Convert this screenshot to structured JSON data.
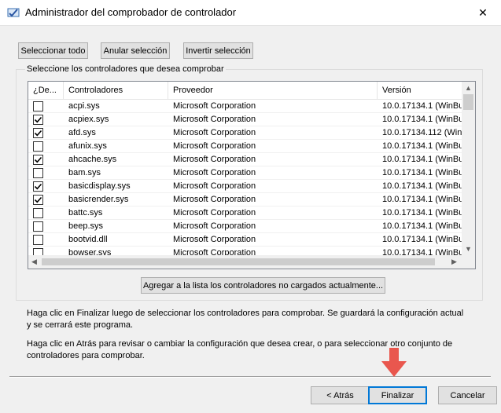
{
  "window": {
    "title": "Administrador del comprobador de controlador",
    "close_glyph": "✕"
  },
  "toolbar": {
    "select_all": "Seleccionar todo",
    "deselect": "Anular selección",
    "invert": "Invertir selección"
  },
  "group": {
    "legend": "Seleccione los controladores que desea comprobar"
  },
  "table": {
    "headers": [
      "¿De...",
      "Controladores",
      "Proveedor",
      "Versión"
    ],
    "rows": [
      {
        "checked": false,
        "name": "acpi.sys",
        "vendor": "Microsoft Corporation",
        "version": "10.0.17134.1 (WinBu"
      },
      {
        "checked": true,
        "name": "acpiex.sys",
        "vendor": "Microsoft Corporation",
        "version": "10.0.17134.1 (WinBu"
      },
      {
        "checked": true,
        "name": "afd.sys",
        "vendor": "Microsoft Corporation",
        "version": "10.0.17134.112 (Win"
      },
      {
        "checked": false,
        "name": "afunix.sys",
        "vendor": "Microsoft Corporation",
        "version": "10.0.17134.1 (WinBu"
      },
      {
        "checked": true,
        "name": "ahcache.sys",
        "vendor": "Microsoft Corporation",
        "version": "10.0.17134.1 (WinBu"
      },
      {
        "checked": false,
        "name": "bam.sys",
        "vendor": "Microsoft Corporation",
        "version": "10.0.17134.1 (WinBu"
      },
      {
        "checked": true,
        "name": "basicdisplay.sys",
        "vendor": "Microsoft Corporation",
        "version": "10.0.17134.1 (WinBu"
      },
      {
        "checked": true,
        "name": "basicrender.sys",
        "vendor": "Microsoft Corporation",
        "version": "10.0.17134.1 (WinBu"
      },
      {
        "checked": false,
        "name": "battc.sys",
        "vendor": "Microsoft Corporation",
        "version": "10.0.17134.1 (WinBu"
      },
      {
        "checked": false,
        "name": "beep.sys",
        "vendor": "Microsoft Corporation",
        "version": "10.0.17134.1 (WinBu"
      },
      {
        "checked": false,
        "name": "bootvid.dll",
        "vendor": "Microsoft Corporation",
        "version": "10.0.17134.1 (WinBu"
      },
      {
        "checked": false,
        "name": "bowser.sys",
        "vendor": "Microsoft Corporation",
        "version": "10.0.17134.1 (WinBu"
      }
    ]
  },
  "add_unloaded": "Agregar a la lista los controladores no cargados actualmente...",
  "info": {
    "finish_text": "Haga clic en Finalizar luego de seleccionar los controladores para comprobar. Se guardará la configuración actual y se cerrará este programa.",
    "back_text": "Haga clic en Atrás para revisar o cambiar la configuración que desea crear, o para seleccionar otro conjunto de controladores para comprobar."
  },
  "footer": {
    "back": "< Atrás",
    "finish": "Finalizar",
    "cancel": "Cancelar"
  },
  "colors": {
    "accent": "#0078d7",
    "pointer_arrow": "#e9574e"
  },
  "icons": {
    "app": "verifier-app-icon",
    "pointer": "red-down-arrow"
  }
}
